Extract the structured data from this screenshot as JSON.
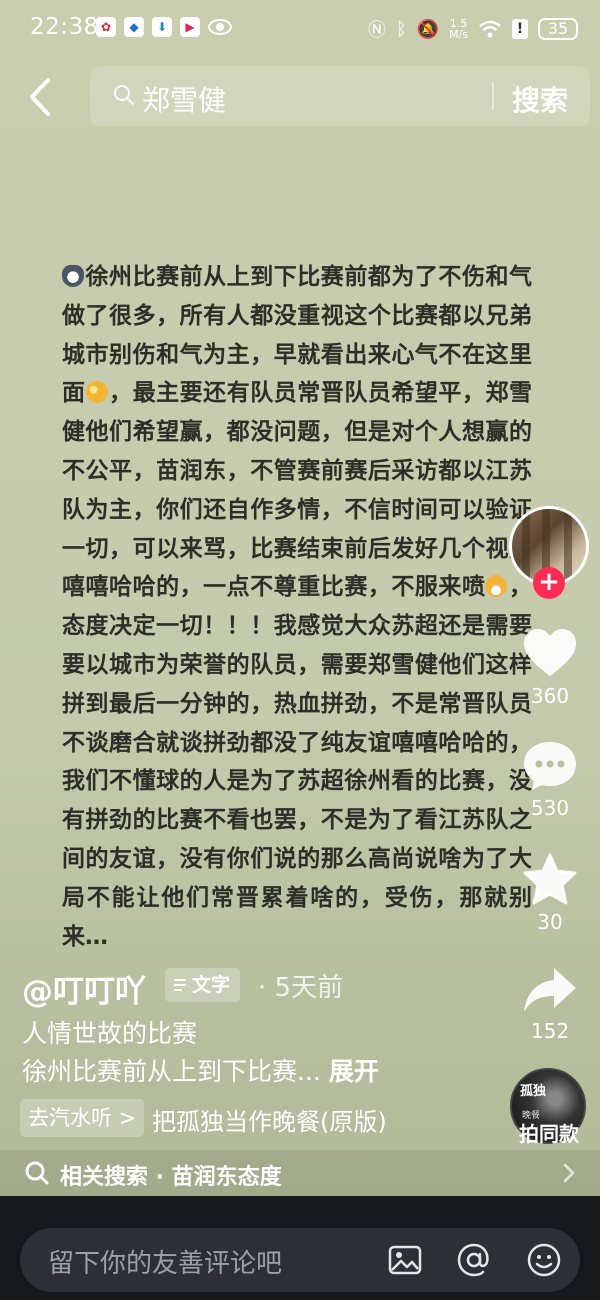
{
  "status_bar": {
    "time": "22:38",
    "net_speed_value": "1.5",
    "net_speed_unit": "M/s",
    "battery": "35"
  },
  "search": {
    "query": "郑雪健",
    "button_label": "搜索"
  },
  "post": {
    "body": "徐州比赛前从上到下比赛前都为了不伤和气做了很多，所有人都没重视这个比赛都以兄弟城市别伤和气为主，早就看出来心气不在这里面",
    "body_2": "，最主要还有队员常晋队员希望平，郑雪健他们希望赢，都没问题，但是对个人想赢的不公平，苗润东，不管赛前赛后采访都以江苏队为主，你们还自作多情，不信时间可以验证一切，可以来骂，比赛结束前后发好几个视频嘻嘻哈哈的，一点不尊重比赛，不服来喷",
    "body_3": "，态度决定一切！！！我感觉大众苏超还是需要要以城市为荣誉的队员，需要郑雪健他们这样拼到最后一分钟的，热血拼劲，不是常晋队员不谈磨合就谈拼劲都没了纯友谊嘻嘻哈哈的，我们不懂球的人是为了苏超徐州看的比赛，没有拼劲的比赛不看也罢，不是为了看江苏队之间的友谊，没有你们说的那么高尚说啥为了大局不能让他们常晋累着啥的，受伤，那就别来…"
  },
  "rail": {
    "follow_symbol": "+",
    "likes": "360",
    "comments": "530",
    "favorites": "30",
    "shares": "152",
    "same_style_label": "拍同款",
    "disc_title": "孤独",
    "disc_sub": "晚餐"
  },
  "author": {
    "name": "@叮叮吖",
    "tag_label": "文字",
    "time": "· 5天前"
  },
  "caption": {
    "title": "人情世故的比赛",
    "preview": "徐州比赛前从上到下比赛...",
    "expand_label": "展开"
  },
  "music": {
    "tag_label": "去汽水听 >",
    "name": "把孤独当作晚餐(原版)"
  },
  "related": {
    "text": "相关搜索 · 苗润东态度"
  },
  "comment": {
    "placeholder": "留下你的友善评论吧"
  },
  "icons": {
    "back": "chevron-left-icon",
    "search": "search-icon",
    "like": "heart-icon",
    "comment": "comment-bubble-icon",
    "favorite": "star-icon",
    "share": "share-arrow-icon",
    "image": "image-icon",
    "mention": "at-icon",
    "emoji": "smiley-icon"
  },
  "colors": {
    "accent": "#fe2c55",
    "background": "#c6ccae",
    "text": "#2e2e28"
  }
}
